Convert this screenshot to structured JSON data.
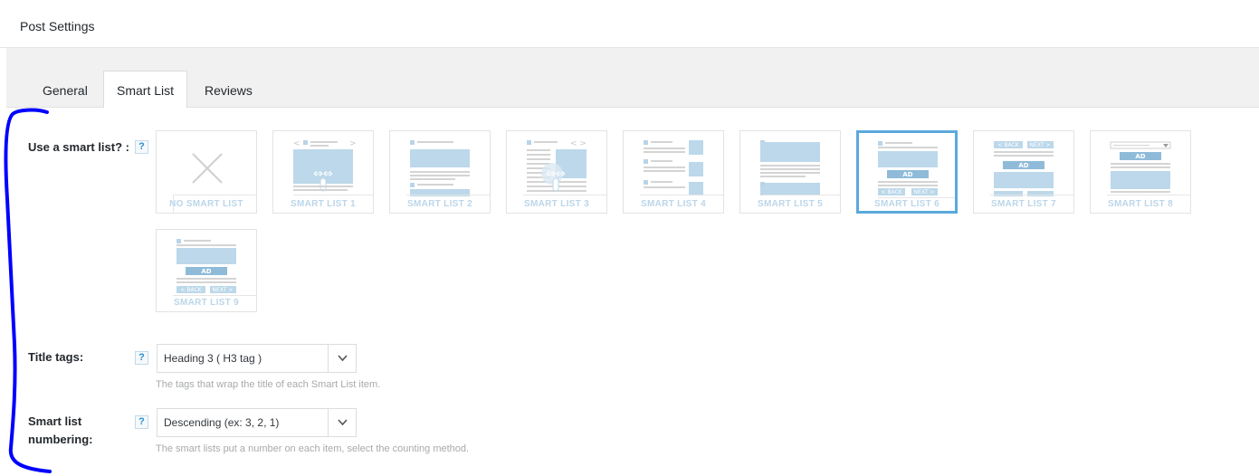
{
  "header": {
    "title": "Post Settings"
  },
  "tabs": [
    {
      "label": "General",
      "active": false
    },
    {
      "label": "Smart List",
      "active": true
    },
    {
      "label": "Reviews",
      "active": false
    }
  ],
  "smart_list_field": {
    "label": "Use a smart list? :",
    "help": "?",
    "options": [
      {
        "caption": "NO SMART LIST",
        "selected": false
      },
      {
        "caption": "SMART LIST 1",
        "selected": false
      },
      {
        "caption": "SMART LIST 2",
        "selected": false
      },
      {
        "caption": "SMART LIST 3",
        "selected": false
      },
      {
        "caption": "SMART LIST 4",
        "selected": false
      },
      {
        "caption": "SMART LIST 5",
        "selected": false
      },
      {
        "caption": "SMART LIST 6",
        "selected": true
      },
      {
        "caption": "SMART LIST 7",
        "selected": false
      },
      {
        "caption": "SMART LIST 8",
        "selected": false
      },
      {
        "caption": "SMART LIST 9",
        "selected": false
      }
    ],
    "thumb_text": {
      "ad": "AD",
      "back": "< BACK",
      "next": "NEXT >"
    }
  },
  "title_tags_field": {
    "label": "Title tags:",
    "help": "?",
    "value": "Heading 3 ( H3 tag )",
    "description": "The tags that wrap the title of each Smart List item."
  },
  "numbering_field": {
    "label_line1": "Smart list",
    "label_line2": "numbering:",
    "help": "?",
    "value": "Descending (ex: 3, 2, 1)",
    "description": "The smart lists put a number on each item, select the counting method."
  },
  "colors": {
    "thumb_blue": "#bcd8ea",
    "thumb_dark_blue": "#8fbbd9",
    "thumb_gray": "#d4d4d4",
    "selected_border": "#5aa9dd",
    "annotation": "#0000ff"
  }
}
